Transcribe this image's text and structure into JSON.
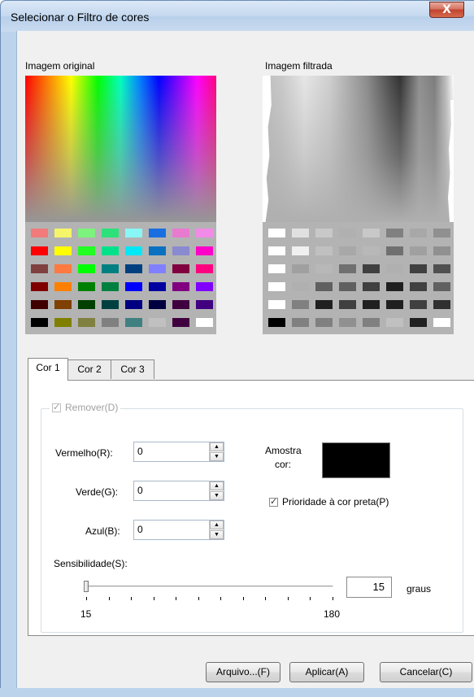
{
  "window": {
    "title": "Selecionar o Filtro de cores",
    "close_glyph": "X"
  },
  "previews": {
    "original_label": "Imagem original",
    "filtered_label": "Imagem filtrada",
    "original_swatch_rows": [
      [
        "#f27a7a",
        "#f5f56a",
        "#7df27d",
        "#2ee07a",
        "#8af5f5",
        "#1a6fe0",
        "#e87ad0",
        "#f28ae8"
      ],
      [
        "#ff0000",
        "#ffff00",
        "#22ff22",
        "#00e28a",
        "#00e8f5",
        "#0a70c0",
        "#8a8ad0",
        "#ff00c8"
      ],
      [
        "#804040",
        "#ff7a40",
        "#00ff00",
        "#008080",
        "#004080",
        "#8080ff",
        "#800040",
        "#ff0080"
      ],
      [
        "#800000",
        "#ff8000",
        "#008000",
        "#008040",
        "#0000ff",
        "#0000a0",
        "#800080",
        "#8000ff"
      ],
      [
        "#400000",
        "#804000",
        "#004000",
        "#004040",
        "#000080",
        "#000040",
        "#400040",
        "#400080"
      ],
      [
        "#000000",
        "#808000",
        "#808040",
        "#808080",
        "#408080",
        "#c0c0c0",
        "#400040",
        "#ffffff"
      ]
    ],
    "filtered_swatch_rows": [
      [
        "#ffffff",
        "#e0e0e0",
        "#c8c8c8",
        "#b0b0b0",
        "#c8c8c8",
        "#808080",
        "#a8a8a8",
        "#909090"
      ],
      [
        "#ffffff",
        "#f0f0f0",
        "#c0c0c0",
        "#a8a8a8",
        "#b8b8b8",
        "#707070",
        "#a0a0a0",
        "#909090"
      ],
      [
        "#ffffff",
        "#a0a0a0",
        "#b8b8b8",
        "#707070",
        "#404040",
        "#b0b0b0",
        "#404040",
        "#505050"
      ],
      [
        "#ffffff",
        "#b0b0b0",
        "#606060",
        "#606060",
        "#404040",
        "#202020",
        "#404040",
        "#606060"
      ],
      [
        "#ffffff",
        "#808080",
        "#202020",
        "#404040",
        "#202020",
        "#202020",
        "#404040",
        "#303030"
      ],
      [
        "#000000",
        "#808080",
        "#808080",
        "#909090",
        "#808080",
        "#c0c0c0",
        "#202020",
        "#ffffff"
      ]
    ]
  },
  "tabs": [
    "Cor 1",
    "Cor 2",
    "Cor 3"
  ],
  "remove": {
    "label": "Remover(D)",
    "checked": true,
    "enabled": false
  },
  "rgb": {
    "red_label": "Vermelho(R):",
    "red_value": "0",
    "green_label": "Verde(G):",
    "green_value": "0",
    "blue_label": "Azul(B):",
    "blue_value": "0"
  },
  "sample": {
    "label_line1": "Amostra",
    "label_line2": "cor:",
    "color": "#000000"
  },
  "black_priority": {
    "label": "Prioridade à cor preta(P)",
    "checked": true
  },
  "sensitivity": {
    "label": "Sensibilidade(S):",
    "min_label": "15",
    "max_label": "180",
    "value": "15",
    "unit": "graus",
    "min": 15,
    "max": 180
  },
  "buttons": {
    "file": "Arquivo...(F)",
    "apply": "Aplicar(A)",
    "cancel": "Cancelar(C)"
  }
}
